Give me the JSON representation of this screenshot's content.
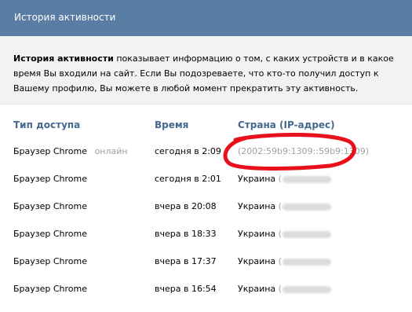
{
  "header": {
    "title": "История активности"
  },
  "info": {
    "bold": "История активности",
    "text": " показывает информацию о том, с каких устройств и в какое время Вы входили на сайт. Если Вы подозреваете, что кто-то получил доступ к Вашему профилю, Вы можете в любой момент прекратить эту активность."
  },
  "table": {
    "columns": [
      "Тип доступа",
      "Время",
      "Страна (IP-адрес)"
    ],
    "rows": [
      {
        "type": "Браузер Chrome",
        "status": "онлайн",
        "time": "сегодня в 2:09",
        "country": "",
        "ip": "(2002:59b9:1309::59b9:1309)"
      },
      {
        "type": "Браузер Chrome",
        "status": "",
        "time": "сегодня в 2:01",
        "country": "Украина",
        "ip": "("
      },
      {
        "type": "Браузер Chrome",
        "status": "",
        "time": "вчера в 20:08",
        "country": "Украина",
        "ip": "("
      },
      {
        "type": "Браузер Chrome",
        "status": "",
        "time": "вчера в 18:33",
        "country": "Украина",
        "ip": "("
      },
      {
        "type": "Браузер Chrome",
        "status": "",
        "time": "вчера в 17:37",
        "country": "Украина",
        "ip": "("
      },
      {
        "type": "Браузер Chrome",
        "status": "",
        "time": "вчера в 16:54",
        "country": "Украина",
        "ip": "("
      }
    ]
  },
  "colors": {
    "header_bg": "#597da3",
    "column_header": "#45688e",
    "annotation": "#e8101a",
    "muted": "#a0a0a0"
  }
}
